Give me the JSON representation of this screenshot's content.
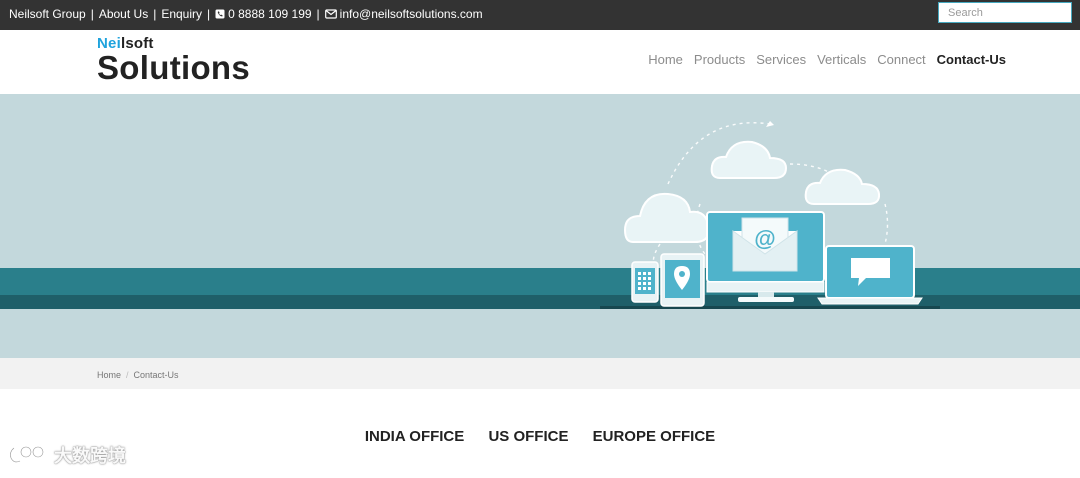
{
  "topbar": {
    "group": "Neilsoft Group",
    "about": "About Us",
    "enquiry": "Enquiry",
    "phone": "0 8888 109 199",
    "email": "info@neilsoftsolutions.com",
    "search_placeholder": "Search"
  },
  "logo": {
    "small_prefix": "Nei",
    "small_suffix": "lsoft",
    "big": "Solutions"
  },
  "nav": {
    "items": [
      "Home",
      "Products",
      "Services",
      "Verticals",
      "Connect",
      "Contact-Us"
    ],
    "active": "Contact-Us"
  },
  "breadcrumb": {
    "home": "Home",
    "current": "Contact-Us"
  },
  "offices": {
    "tabs": [
      "INDIA OFFICE",
      "US OFFICE",
      "EUROPE OFFICE"
    ]
  },
  "hero": {
    "email_symbol": "@"
  },
  "watermark": {
    "text": "大数跨境"
  },
  "colors": {
    "topbar": "#333333",
    "accent": "#1fa3dd",
    "hero_bg": "#c3d8dc",
    "stripe": "#2a7f8b",
    "device": "#4fb3cb"
  }
}
